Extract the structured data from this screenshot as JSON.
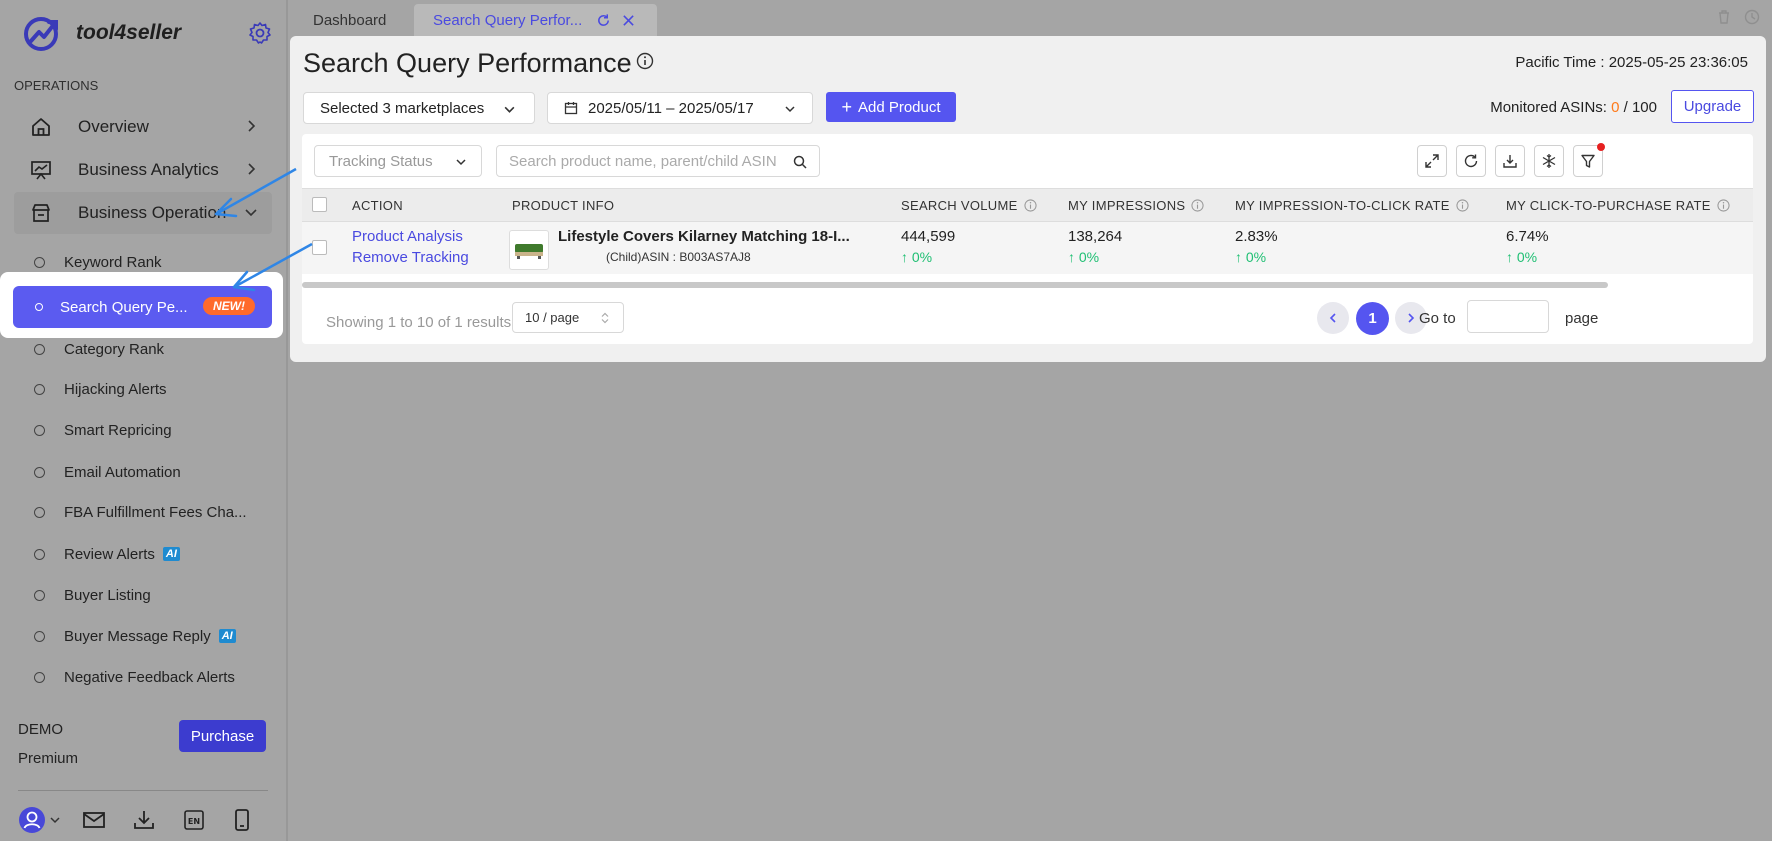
{
  "app": {
    "name": "tool4seller",
    "brand_color": "#5555f0",
    "accent_orange": "#ff6a2b"
  },
  "sidebar": {
    "section_label": "OPERATIONS",
    "top_items": [
      {
        "label": "Overview",
        "icon": "home-icon"
      },
      {
        "label": "Business Analytics",
        "icon": "chart-board-icon"
      },
      {
        "label": "Business Operation",
        "icon": "store-icon",
        "expanded": true
      }
    ],
    "sub_items": [
      {
        "label": "Keyword Rank"
      },
      {
        "label": "Search Query Pe...",
        "badge": "NEW!",
        "active": true
      },
      {
        "label": "Category Rank"
      },
      {
        "label": "Hijacking Alerts"
      },
      {
        "label": "Smart Repricing"
      },
      {
        "label": "Email Automation"
      },
      {
        "label": "FBA Fulfillment Fees Cha..."
      },
      {
        "label": "Review Alerts",
        "badge": "AI"
      },
      {
        "label": "Buyer Listing"
      },
      {
        "label": "Buyer Message Reply",
        "badge": "AI"
      },
      {
        "label": "Negative Feedback Alerts"
      }
    ],
    "footer": {
      "account": "DEMO",
      "plan": "Premium",
      "purchase_label": "Purchase",
      "icons": [
        "user-avatar-icon",
        "mail-icon",
        "download-icon",
        "language-en-icon",
        "mobile-icon"
      ]
    }
  },
  "tabs": [
    {
      "label": "Dashboard"
    },
    {
      "label": "Search Query Perfor...",
      "active": true
    }
  ],
  "page": {
    "title": "Search Query Performance",
    "pacific_time_label": "Pacific Time :",
    "pacific_time_value": "2025-05-25 23:36:05",
    "marketplaces_label": "Selected 3 marketplaces",
    "date_range": "2025/05/11 – 2025/05/17",
    "add_product_label": "Add Product",
    "monitored_label": "Monitored ASINs:",
    "monitored_used": "0",
    "monitored_sep": "/",
    "monitored_total": "100",
    "upgrade_label": "Upgrade"
  },
  "filters": {
    "tracking_status_placeholder": "Tracking Status",
    "search_placeholder": "Search product name, parent/child ASIN"
  },
  "table": {
    "columns": [
      "ACTION",
      "PRODUCT INFO",
      "SEARCH VOLUME",
      "MY IMPRESSIONS",
      "MY IMPRESSION-TO-CLICK RATE",
      "MY CLICK-TO-PURCHASE RATE"
    ],
    "rows": [
      {
        "action_1": "Product Analysis",
        "action_2": "Remove Tracking",
        "product_name": "Lifestyle Covers Kilarney Matching 18-I...",
        "asin": "(Child)ASIN : B003AS7AJ8",
        "search_volume": "444,599",
        "search_volume_change": "0%",
        "impressions": "138,264",
        "impressions_change": "0%",
        "ctr": "2.83%",
        "ctr_change": "0%",
        "cpr": "6.74%",
        "cpr_change": "0%"
      }
    ]
  },
  "pagination": {
    "showing": "Showing 1 to 10 of 1 results.",
    "per_page": "10 / page",
    "current_page": "1",
    "goto_label": "Go to",
    "page_label": "page"
  }
}
